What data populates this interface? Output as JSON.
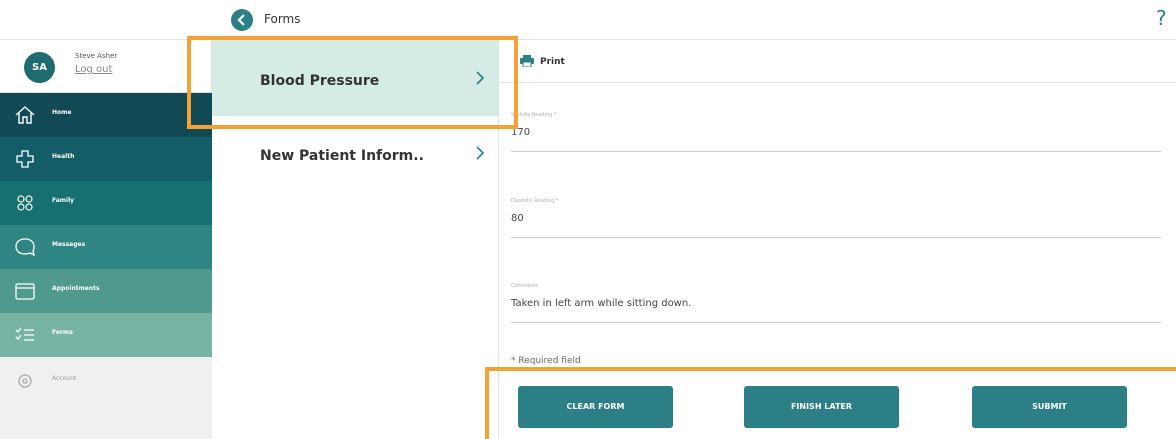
{
  "header": {
    "title": "Forms",
    "help": "?"
  },
  "user": {
    "initials": "SA",
    "name": "Steve Asher",
    "logout": "Log out"
  },
  "nav": {
    "items": [
      {
        "label": "Home",
        "icon": "home-icon",
        "color": "#114a55"
      },
      {
        "label": "Health",
        "icon": "medical-cross-icon",
        "color": "#135e66"
      },
      {
        "label": "Family",
        "icon": "family-icon",
        "color": "#177070"
      },
      {
        "label": "Messages",
        "icon": "message-bubble-icon",
        "color": "#2f8582"
      },
      {
        "label": "Appointments",
        "icon": "calendar-icon",
        "color": "#4f9a8c"
      },
      {
        "label": "Forms",
        "icon": "forms-checklist-icon",
        "color": "#78b4a4",
        "active": true
      },
      {
        "label": "Account",
        "icon": "gear-icon",
        "color": "#f0f0f0"
      }
    ]
  },
  "forms": [
    {
      "label": "Blood Pressure",
      "selected": true
    },
    {
      "label": "New Patient Inform..",
      "selected": false
    }
  ],
  "toolbar": {
    "print_label": "Print"
  },
  "fields": [
    {
      "label": "Systolic Reading *",
      "value": "170"
    },
    {
      "label": "Diastolic Reading *",
      "value": "80"
    },
    {
      "label": "Comments",
      "value": "Taken in left arm while sitting down."
    }
  ],
  "required_note": "* Required field",
  "buttons": {
    "clear": "CLEAR FORM",
    "finish_later": "FINISH LATER",
    "submit": "SUBMIT"
  },
  "colors": {
    "accent": "#2c7f84",
    "highlight": "#f4a135",
    "selected_bg": "#d5ece6"
  }
}
